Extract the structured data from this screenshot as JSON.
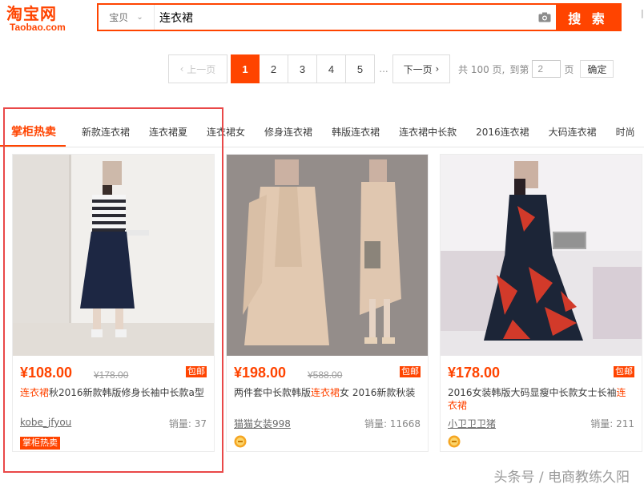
{
  "header": {
    "logo_cn": "淘宝网",
    "logo_en": "Taobao.com",
    "search_type": "宝贝",
    "search_value": "连衣裙",
    "search_button": "搜 索"
  },
  "pager": {
    "prev": "上一页",
    "pages": [
      "1",
      "2",
      "3",
      "4",
      "5"
    ],
    "active_page": "1",
    "ellipsis": "...",
    "next": "下一页",
    "total_label": "共 100 页,",
    "goto_label": "到第",
    "goto_value": "2",
    "page_unit": "页",
    "confirm": "确定"
  },
  "tabs": [
    "掌柜热卖",
    "新款连衣裙",
    "连衣裙夏",
    "连衣裙女",
    "修身连衣裙",
    "韩版连衣裙",
    "连衣裙中长款",
    "2016连衣裙",
    "大码连衣裙",
    "时尚"
  ],
  "products": [
    {
      "price": "¥108.00",
      "original": "¥178.00",
      "ship_badge": "包邮",
      "title_hl": "连衣裙",
      "title_rest": "秋2016新款韩版修身长袖中长款a型",
      "shop": "kobe_jfyou",
      "sales": "销量: 37",
      "tag": "掌柜热卖"
    },
    {
      "price": "¥198.00",
      "original": "¥588.00",
      "ship_badge": "包邮",
      "title_pre": "两件套中长款韩版",
      "title_hl": "连衣裙",
      "title_rest": "女 2016新款秋装",
      "shop": "猫猫女装998",
      "sales": "销量: 11668"
    },
    {
      "price": "¥178.00",
      "ship_badge": "包邮",
      "title_pre": "2016女装韩版大码显瘦中长款女士长袖",
      "title_hl": "连衣裙",
      "shop": "小卫卫卫猪",
      "sales": "销量: 211"
    }
  ],
  "watermark": "头条号 / 电商教练久阳",
  "colors": {
    "brand": "#ff4400",
    "highlight_box": "#e94848"
  }
}
